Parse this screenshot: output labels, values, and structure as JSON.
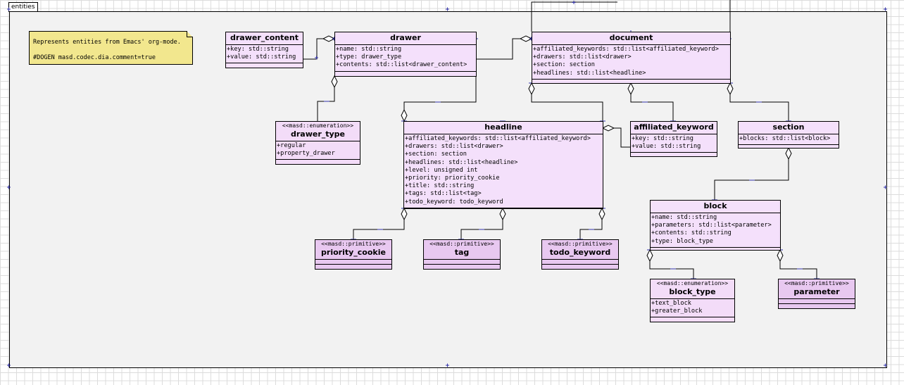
{
  "package": {
    "name": "entities"
  },
  "note": {
    "line1": "Represents entities from Emacs' org-mode.",
    "line2": "#DOGEN masd.codec.dia.comment=true"
  },
  "classes": {
    "drawer_content": {
      "name": "drawer_content",
      "attributes": [
        "+key: std::string",
        "+value: std::string"
      ]
    },
    "drawer": {
      "name": "drawer",
      "attributes": [
        "+name: std::string",
        "+type: drawer_type",
        "+contents: std::list<drawer_content>"
      ]
    },
    "document": {
      "name": "document",
      "attributes": [
        "+affiliated_keywords: std::list<affiliated_keyword>",
        "+drawers: std::list<drawer>",
        "+section: section",
        "+headlines: std::list<headline>"
      ]
    },
    "drawer_type": {
      "stereotype": "<<masd::enumeration>>",
      "name": "drawer_type",
      "attributes": [
        "+regular",
        "+property_drawer"
      ]
    },
    "headline": {
      "name": "headline",
      "attributes": [
        "+affiliated_keywords: std::list<affiliated_keyword>",
        "+drawers: std::list<drawer>",
        "+section: section",
        "+headlines: std::list<headline>",
        "+level: unsigned int",
        "+priority: priority_cookie",
        "+title: std::string",
        "+tags: std::list<tag>",
        "+todo_keyword: todo_keyword"
      ]
    },
    "affiliated_keyword": {
      "name": "affiliated_keyword",
      "attributes": [
        "+key: std::string",
        "+value: std::string"
      ]
    },
    "section": {
      "name": "section",
      "attributes": [
        "+blocks: std::list<block>"
      ]
    },
    "block": {
      "name": "block",
      "attributes": [
        "+name: std::string",
        "+parameters: std::list<parameter>",
        "+contents: std::string",
        "+type: block_type"
      ]
    },
    "priority_cookie": {
      "stereotype": "<<masd::primitive>>",
      "name": "priority_cookie"
    },
    "tag": {
      "stereotype": "<<masd::primitive>>",
      "name": "tag"
    },
    "todo_keyword": {
      "stereotype": "<<masd::primitive>>",
      "name": "todo_keyword"
    },
    "block_type": {
      "stereotype": "<<masd::enumeration>>",
      "name": "block_type",
      "attributes": [
        "+text_block",
        "+greater_block"
      ]
    },
    "parameter": {
      "stereotype": "<<masd::primitive>>",
      "name": "parameter"
    }
  },
  "colors": {
    "class_fill": "#f4e0fb",
    "primitive_fill": "#e8c8f0",
    "note_fill": "#f2e78e",
    "package_fill": "#f2f2f2",
    "connector_endpoint": "#3333aa"
  }
}
